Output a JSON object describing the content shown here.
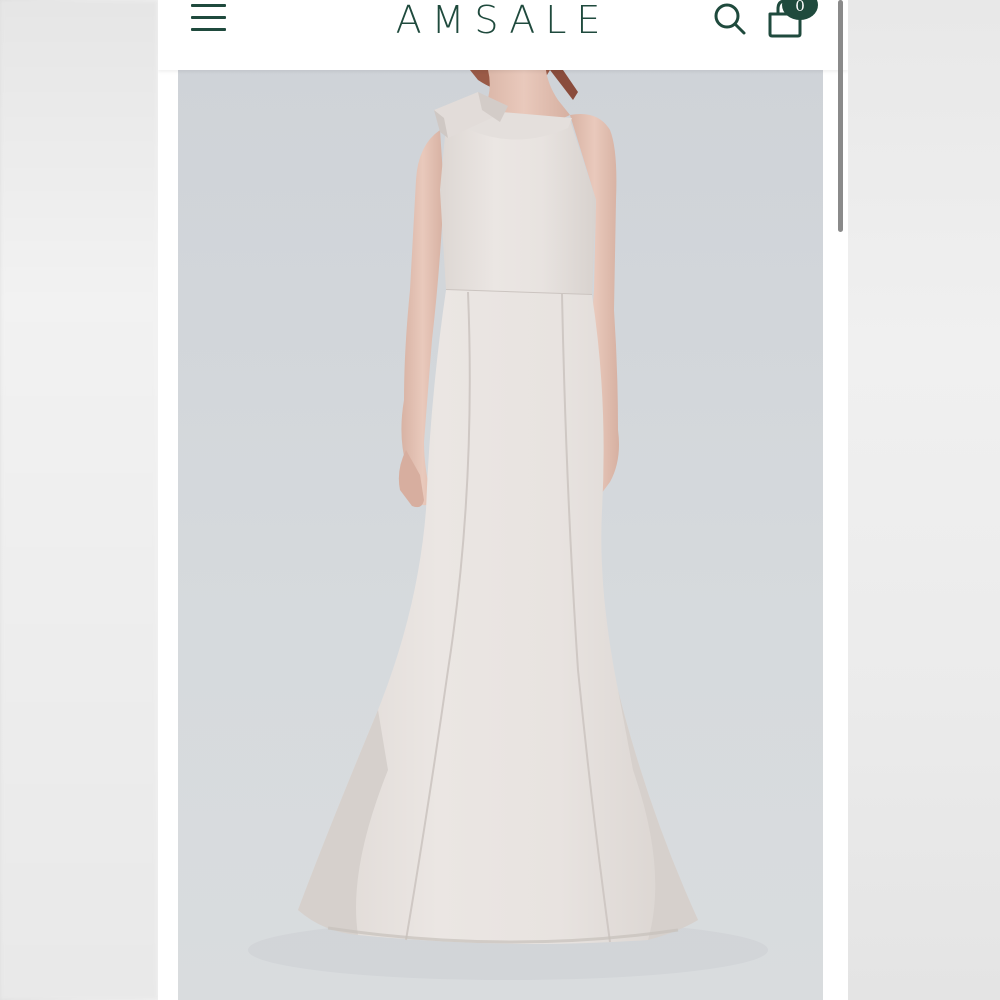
{
  "header": {
    "brand": "AMSALE",
    "cart_count": "0",
    "menu_icon": "hamburger-menu-icon",
    "search_icon": "search-icon",
    "cart_icon": "shopping-bag-icon"
  },
  "product": {
    "image_subject": "one-shoulder-bow-mermaid-gown"
  },
  "colors": {
    "brand_green": "#1f4a3d",
    "photo_background": "#d3d7db",
    "gown": "#e7e2df"
  }
}
